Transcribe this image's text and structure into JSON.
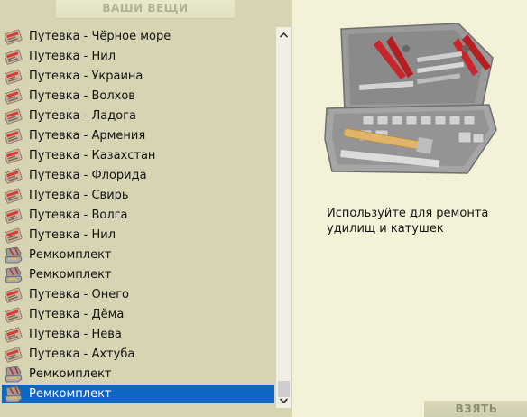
{
  "header": {
    "title": "ВАШИ ВЕЩИ"
  },
  "inventory": {
    "items": [
      {
        "label": "Путевка - Чёрное море",
        "icon": "voucher-icon"
      },
      {
        "label": "Путевка - Нил",
        "icon": "voucher-icon"
      },
      {
        "label": "Путевка - Украина",
        "icon": "voucher-icon"
      },
      {
        "label": "Путевка - Волхов",
        "icon": "voucher-icon"
      },
      {
        "label": "Путевка - Ладога",
        "icon": "voucher-icon"
      },
      {
        "label": "Путевка - Армения",
        "icon": "voucher-icon"
      },
      {
        "label": "Путевка - Казахстан",
        "icon": "voucher-icon"
      },
      {
        "label": "Путевка - Флорида",
        "icon": "voucher-icon"
      },
      {
        "label": "Путевка - Свирь",
        "icon": "voucher-icon"
      },
      {
        "label": "Путевка - Волга",
        "icon": "voucher-icon"
      },
      {
        "label": "Путевка - Нил",
        "icon": "voucher-icon"
      },
      {
        "label": "Ремкомплект",
        "icon": "toolkit-icon"
      },
      {
        "label": "Ремкомплект",
        "icon": "toolkit-icon"
      },
      {
        "label": "Путевка - Онего",
        "icon": "voucher-icon"
      },
      {
        "label": "Путевка - Дёма",
        "icon": "voucher-icon"
      },
      {
        "label": "Путевка - Нева",
        "icon": "voucher-icon"
      },
      {
        "label": "Путевка - Ахтуба",
        "icon": "voucher-icon"
      },
      {
        "label": "Ремкомплект",
        "icon": "toolkit-icon"
      },
      {
        "label": "Ремкомплект",
        "icon": "toolkit-icon",
        "selected": true
      }
    ]
  },
  "details": {
    "image_icon": "toolkit-case-icon",
    "description": "Используйте для ремонта удилищ и катушек"
  },
  "actions": {
    "take_label": "ВЗЯТЬ"
  },
  "colors": {
    "panel_bg": "#d6d4b2",
    "detail_bg": "#f3f2d8",
    "selection": "#1066c4"
  }
}
